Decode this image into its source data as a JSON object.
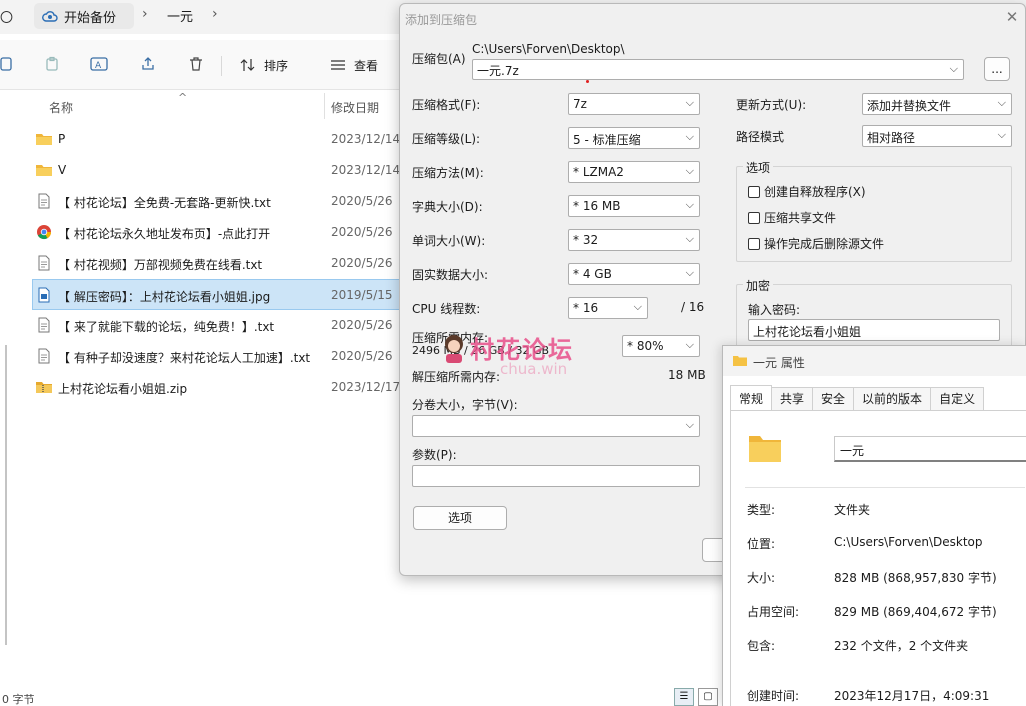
{
  "explorer": {
    "breadcrumb": {
      "first": "〇",
      "backup_label": "开始备份",
      "current": "一元"
    },
    "toolbar": {
      "sort_label": "排序",
      "view_label": "查看"
    },
    "columns": {
      "name": "名称",
      "date": "修改日期"
    },
    "files": [
      {
        "name": "P",
        "date": "2023/12/14",
        "type": "folder"
      },
      {
        "name": "V",
        "date": "2023/12/14",
        "type": "folder"
      },
      {
        "name": "【 村花论坛】全免费-无套路-更新快.txt",
        "date": "2020/5/26",
        "type": "txt"
      },
      {
        "name": "【 村花论坛永久地址发布页】-点此打开",
        "date": "2020/5/26",
        "type": "chrome"
      },
      {
        "name": "【 村花视频】万部视频免费在线看.txt",
        "date": "2020/5/26",
        "type": "txt"
      },
      {
        "name": "【 解压密码】：上村花论坛看小姐姐.jpg",
        "date": "2019/5/15",
        "type": "jpg"
      },
      {
        "name": "【 来了就能下载的论坛，纯免费！】.txt",
        "date": "2020/5/26",
        "type": "txt"
      },
      {
        "name": "【 有种子却没速度？来村花论坛人工加速】.txt",
        "date": "2020/5/26",
        "type": "txt"
      },
      {
        "name": "上村花论坛看小姐姐.zip",
        "date": "2023/12/17",
        "type": "zip"
      }
    ],
    "status": "0 字节"
  },
  "archive_dialog": {
    "title": "添加到压缩包",
    "archive_label": "压缩包(A)",
    "archive_path": "C:\\Users\\Forven\\Desktop\\",
    "archive_name": "一元.7z",
    "browse_label": "...",
    "format_label": "压缩格式(F):",
    "format_value": "7z",
    "level_label": "压缩等级(L):",
    "level_value": "5 - 标准压缩",
    "method_label": "压缩方法(M):",
    "method_value": "*  LZMA2",
    "dict_label": "字典大小(D):",
    "dict_value": "*  16 MB",
    "word_label": "单词大小(W):",
    "word_value": "*  32",
    "solid_label": "固实数据大小:",
    "solid_value": "*  4 GB",
    "cpu_label": "CPU 线程数:",
    "cpu_value": "*  16",
    "cpu_total": "/ 16",
    "mem_label": "压缩所需内存:",
    "mem_value": "2496 MB / 26 GB / 32 GB",
    "mem_percent": "*  80%",
    "decomp_label": "解压缩所需内存:",
    "decomp_value": "18 MB",
    "split_label": "分卷大小，字节(V):",
    "params_label": "参数(P):",
    "options_button": "选项",
    "update_label": "更新方式(U):",
    "update_value": "添加并替换文件",
    "path_label": "路径模式",
    "path_value": "相对路径",
    "options_group": "选项",
    "opt_sfx": "创建自释放程序(X)",
    "opt_shared": "压缩共享文件",
    "opt_delete": "操作完成后删除源文件",
    "encrypt_group": "加密",
    "password_label": "输入密码:",
    "password_value": "上村花论坛看小姐姐"
  },
  "watermark": {
    "text": "村花论坛",
    "sub": "chua.win"
  },
  "props_dialog": {
    "title": "一元 属性",
    "tabs": [
      "常规",
      "共享",
      "安全",
      "以前的版本",
      "自定义"
    ],
    "name": "一元",
    "type_label": "类型:",
    "type_value": "文件夹",
    "location_label": "位置:",
    "location_value": "C:\\Users\\Forven\\Desktop",
    "size_label": "大小:",
    "size_value": "828 MB (868,957,830 字节)",
    "disk_label": "占用空间:",
    "disk_value": "829 MB (869,404,672 字节)",
    "contains_label": "包含:",
    "contains_value": "232 个文件，2 个文件夹",
    "created_label": "创建时间:",
    "created_value": "2023年12月17日，4:09:31"
  },
  "colors": {
    "selection": "#cce4f7",
    "folder": "#f5c244",
    "watermark": "#e8508a"
  }
}
